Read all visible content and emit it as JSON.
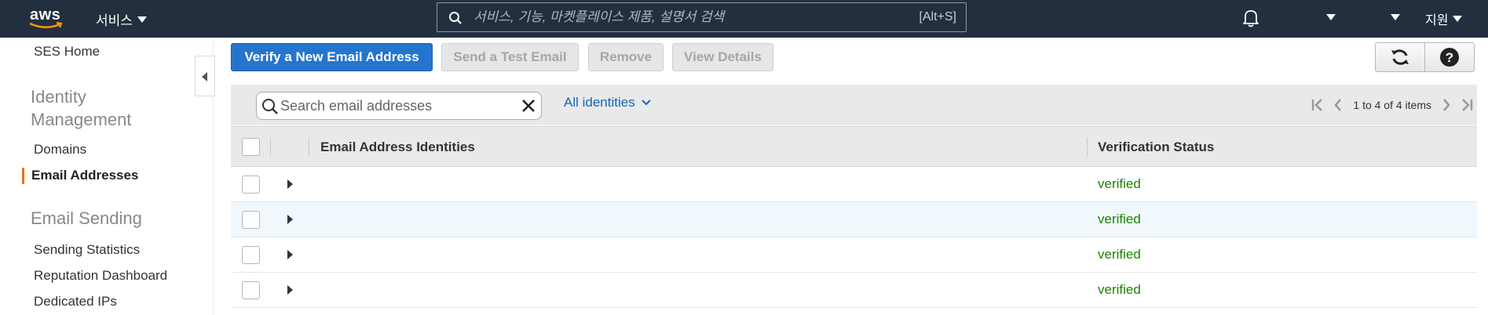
{
  "topnav": {
    "logo_text": "aws",
    "services_label": "서비스",
    "search_placeholder": "서비스, 기능, 마켓플레이스 제품, 설명서 검색",
    "search_shortcut": "[Alt+S]",
    "support_label": "지원",
    "icons": [
      "bell-icon",
      "caret-down-icon",
      "search-icon"
    ]
  },
  "sidebar": {
    "home": "SES Home",
    "identity_heading_line1": "Identity",
    "identity_heading_line2": "Management",
    "domains": "Domains",
    "email_addresses": "Email Addresses",
    "sending_heading": "Email Sending",
    "sending_statistics": "Sending Statistics",
    "reputation_dashboard": "Reputation Dashboard",
    "dedicated_ips": "Dedicated IPs",
    "active_item": "Email Addresses",
    "accent_color": "#ec7211"
  },
  "toolbar": {
    "verify_label": "Verify a New Email Address",
    "send_test_label": "Send a Test Email",
    "remove_label": "Remove",
    "view_details_label": "View Details",
    "icons": [
      "refresh-icon",
      "help-icon"
    ]
  },
  "filter": {
    "search_placeholder": "Search email addresses",
    "identities_filter": "All identities",
    "pagination_text": "1 to 4 of 4 items"
  },
  "table": {
    "columns": [
      "Email Address Identities",
      "Verification Status"
    ],
    "rows": [
      {
        "email": "",
        "status": "verified"
      },
      {
        "email": "",
        "status": "verified"
      },
      {
        "email": "",
        "status": "verified"
      },
      {
        "email": "",
        "status": "verified"
      }
    ],
    "status_color": "#1d8102"
  }
}
